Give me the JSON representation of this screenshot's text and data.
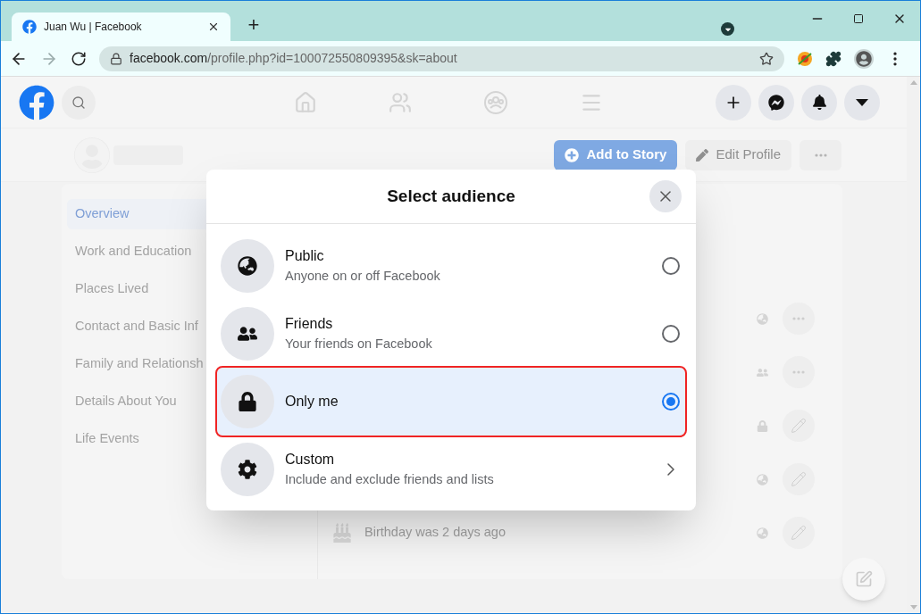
{
  "browser": {
    "tab_title": "Juan Wu | Facebook",
    "new_tab": "+",
    "url_host": "facebook.com",
    "url_path": "/profile.php?id=100072550809395&sk=about"
  },
  "profile_actions": [
    {
      "kind": "primary",
      "label": "Add to Story"
    },
    {
      "kind": "secondary",
      "label": "Edit Profile"
    },
    {
      "kind": "more"
    }
  ],
  "sidebar": {
    "items": [
      {
        "label": "Overview",
        "selected": true
      },
      {
        "label": "Work and Education",
        "selected": false
      },
      {
        "label": "Places Lived",
        "selected": false
      },
      {
        "label": "Contact and Basic Inf",
        "selected": false
      },
      {
        "label": "Family and Relationsh",
        "selected": false
      },
      {
        "label": "Details About You",
        "selected": false
      },
      {
        "label": "Life Events",
        "selected": false
      }
    ]
  },
  "birthday": {
    "text": "Birthday was 2 days ago"
  },
  "modal": {
    "title": "Select audience",
    "options": [
      {
        "title": "Public",
        "subtitle": "Anyone on or off Facebook",
        "kind": "radio",
        "selected": false
      },
      {
        "title": "Friends",
        "subtitle": "Your friends on Facebook",
        "kind": "radio",
        "selected": false
      },
      {
        "title": "Only me",
        "kind": "radio",
        "selected": true
      },
      {
        "title": "Custom",
        "subtitle": "Include and exclude friends and lists",
        "kind": "link",
        "selected": false
      }
    ]
  }
}
